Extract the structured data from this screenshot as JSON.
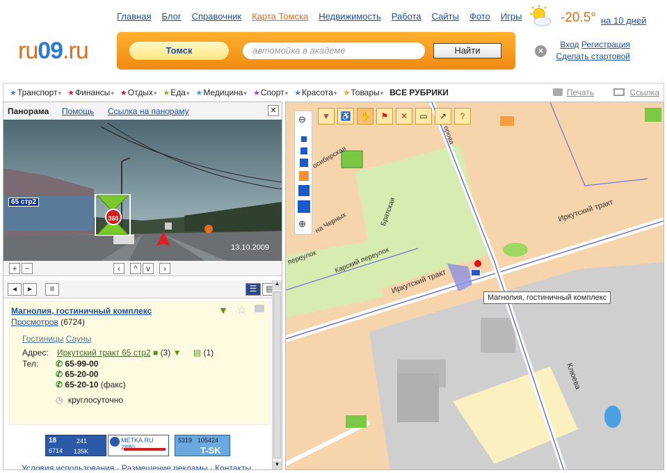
{
  "logo": {
    "text_pre": "ru",
    "text_oo": "09",
    "text_post": ".ru"
  },
  "topnav": [
    "Главная",
    "Блог",
    "Справочник",
    "Карта Томска",
    "Недвижимость",
    "Работа",
    "Сайты",
    "Фото",
    "Игры"
  ],
  "weather": {
    "temp": "-20.5°",
    "forecast": "на 10 дней"
  },
  "search": {
    "city": "Томск",
    "placeholder": "автомойка в академе",
    "button": "Найти"
  },
  "auth": {
    "login": "Вход",
    "register": "Регистрация",
    "start": "Сделать стартовой"
  },
  "rubrics": [
    {
      "label": "Транспорт",
      "color": "#3a7fd0"
    },
    {
      "label": "Финансы",
      "color": "#d02020"
    },
    {
      "label": "Отдых",
      "color": "#d02020"
    },
    {
      "label": "Еда",
      "color": "#7ab82a"
    },
    {
      "label": "Медицина",
      "color": "#3a9fe0"
    },
    {
      "label": "Спорт",
      "color": "#a040c0"
    },
    {
      "label": "Красота",
      "color": "#3a7fd0"
    },
    {
      "label": "Товары",
      "color": "#f0a020"
    }
  ],
  "rubrics_all": "ВСЕ РУБРИКИ",
  "print": "Печать",
  "link": "Ссылка",
  "panorama": {
    "title": "Панорама",
    "help": "Помощь",
    "link": "Ссылка на панораму",
    "house_label": "65 стр2",
    "date": "13.10.2009",
    "badge": "360"
  },
  "card": {
    "name": "Магнолия, гостиничный комплекс",
    "views_label": "Просмотров",
    "views": "(6724)",
    "cat1": "Гостиницы",
    "cat2": "Сауны",
    "addr_label": "Адрес:",
    "address": "Иркутский тракт 65 стр2",
    "photos": "(3)",
    "notes": "(1)",
    "tel_label": "Тел:",
    "phones": [
      "65-99-00",
      "65-20-00",
      "65-20-10"
    ],
    "fax": "(факс)",
    "hours": "круглосуточно"
  },
  "counters": {
    "c1a": "18",
    "c1b": "241",
    "c1c": "6714",
    "c1d": "135K",
    "c2": "METKA.RU 2880",
    "c3a": "5319",
    "c3b": "105424",
    "c3c": "T-SK"
  },
  "footer": "Условия использования · Размещение рекламы · Контакты",
  "map": {
    "tooltip": "Магнолия, гостиничный комплекс",
    "streets": [
      "Иркутский тракт",
      "Иркутский тракт",
      "Клюева",
      "Карский переулок",
      "Братская",
      "на Черных",
      "переулок",
      "осибирская",
      "орова"
    ]
  }
}
